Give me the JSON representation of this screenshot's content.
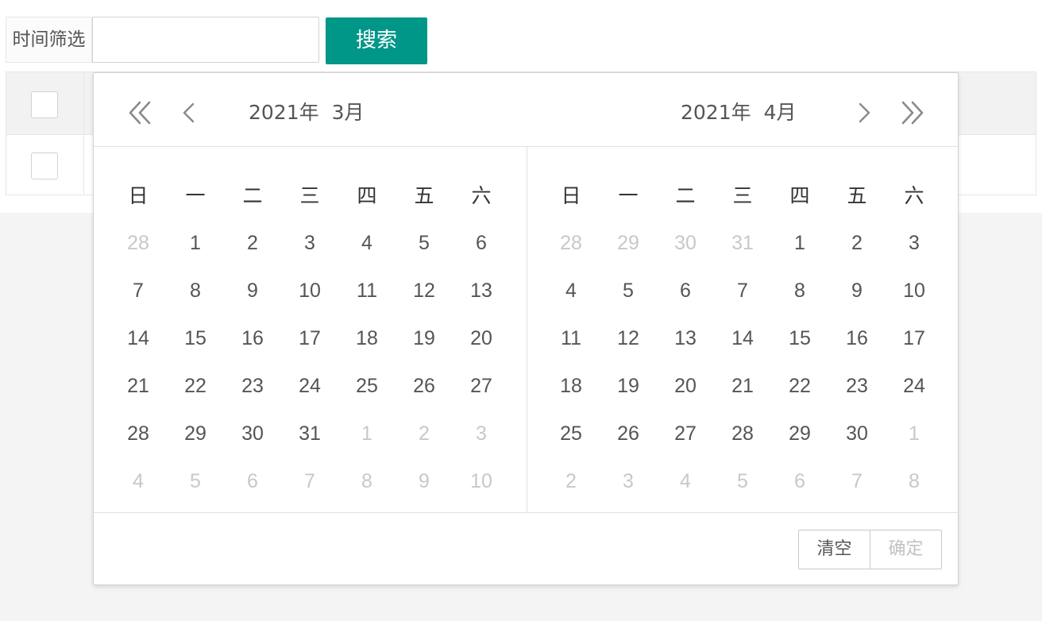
{
  "filter": {
    "label": "时间筛选",
    "input_value": "",
    "input_placeholder": "",
    "search_label": "搜索"
  },
  "table": {
    "header_checked": false,
    "rows": [
      {
        "checked": false
      }
    ]
  },
  "picker": {
    "nav_icons": {
      "prev_year": "double-chevron-left-icon",
      "prev_month": "chevron-left-icon",
      "next_month": "chevron-right-icon",
      "next_year": "double-chevron-right-icon"
    },
    "colors": {
      "accent": "#009688",
      "current_month_day": "#555555",
      "other_month_day": "#c8c8c8"
    },
    "left": {
      "year_label": "2021年",
      "month_label": "3月",
      "weekdays": [
        "日",
        "一",
        "二",
        "三",
        "四",
        "五",
        "六"
      ],
      "weeks": [
        [
          {
            "d": "28",
            "other": true
          },
          {
            "d": "1"
          },
          {
            "d": "2"
          },
          {
            "d": "3"
          },
          {
            "d": "4"
          },
          {
            "d": "5"
          },
          {
            "d": "6"
          }
        ],
        [
          {
            "d": "7"
          },
          {
            "d": "8"
          },
          {
            "d": "9"
          },
          {
            "d": "10"
          },
          {
            "d": "11"
          },
          {
            "d": "12"
          },
          {
            "d": "13"
          }
        ],
        [
          {
            "d": "14"
          },
          {
            "d": "15"
          },
          {
            "d": "16"
          },
          {
            "d": "17"
          },
          {
            "d": "18"
          },
          {
            "d": "19"
          },
          {
            "d": "20"
          }
        ],
        [
          {
            "d": "21"
          },
          {
            "d": "22"
          },
          {
            "d": "23"
          },
          {
            "d": "24"
          },
          {
            "d": "25"
          },
          {
            "d": "26"
          },
          {
            "d": "27"
          }
        ],
        [
          {
            "d": "28"
          },
          {
            "d": "29"
          },
          {
            "d": "30"
          },
          {
            "d": "31"
          },
          {
            "d": "1",
            "other": true
          },
          {
            "d": "2",
            "other": true
          },
          {
            "d": "3",
            "other": true
          }
        ],
        [
          {
            "d": "4",
            "other": true
          },
          {
            "d": "5",
            "other": true
          },
          {
            "d": "6",
            "other": true
          },
          {
            "d": "7",
            "other": true
          },
          {
            "d": "8",
            "other": true
          },
          {
            "d": "9",
            "other": true
          },
          {
            "d": "10",
            "other": true
          }
        ]
      ]
    },
    "right": {
      "year_label": "2021年",
      "month_label": "4月",
      "weekdays": [
        "日",
        "一",
        "二",
        "三",
        "四",
        "五",
        "六"
      ],
      "weeks": [
        [
          {
            "d": "28",
            "other": true
          },
          {
            "d": "29",
            "other": true
          },
          {
            "d": "30",
            "other": true
          },
          {
            "d": "31",
            "other": true
          },
          {
            "d": "1"
          },
          {
            "d": "2"
          },
          {
            "d": "3"
          }
        ],
        [
          {
            "d": "4"
          },
          {
            "d": "5"
          },
          {
            "d": "6"
          },
          {
            "d": "7"
          },
          {
            "d": "8"
          },
          {
            "d": "9"
          },
          {
            "d": "10"
          }
        ],
        [
          {
            "d": "11"
          },
          {
            "d": "12"
          },
          {
            "d": "13"
          },
          {
            "d": "14"
          },
          {
            "d": "15"
          },
          {
            "d": "16"
          },
          {
            "d": "17"
          }
        ],
        [
          {
            "d": "18"
          },
          {
            "d": "19"
          },
          {
            "d": "20"
          },
          {
            "d": "21"
          },
          {
            "d": "22"
          },
          {
            "d": "23"
          },
          {
            "d": "24"
          }
        ],
        [
          {
            "d": "25"
          },
          {
            "d": "26"
          },
          {
            "d": "27"
          },
          {
            "d": "28"
          },
          {
            "d": "29"
          },
          {
            "d": "30"
          },
          {
            "d": "1",
            "other": true
          }
        ],
        [
          {
            "d": "2",
            "other": true
          },
          {
            "d": "3",
            "other": true
          },
          {
            "d": "4",
            "other": true
          },
          {
            "d": "5",
            "other": true
          },
          {
            "d": "6",
            "other": true
          },
          {
            "d": "7",
            "other": true
          },
          {
            "d": "8",
            "other": true
          }
        ]
      ]
    },
    "footer": {
      "clear_label": "清空",
      "confirm_label": "确定",
      "confirm_disabled": true
    }
  }
}
